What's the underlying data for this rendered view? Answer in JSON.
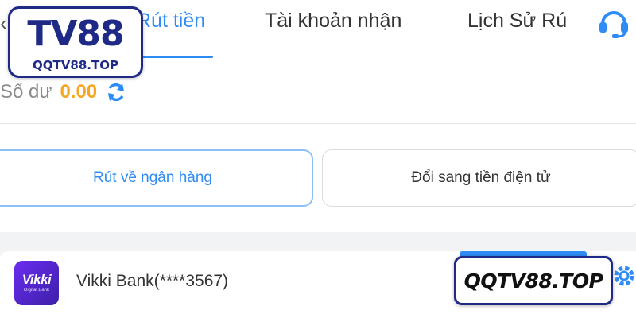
{
  "header": {
    "back_icon": "chevron-left-icon",
    "tabs": [
      {
        "label": "Rút tiền",
        "active": true
      },
      {
        "label": "Tài khoản nhận",
        "active": false
      },
      {
        "label": "Lịch Sử Rú",
        "active": false
      }
    ],
    "support_icon": "headset-icon"
  },
  "balance": {
    "label": "Số dư",
    "value": "0.00",
    "refresh_icon": "refresh-icon"
  },
  "options": [
    {
      "label": "Rút về ngân hàng",
      "selected": true
    },
    {
      "label": "Đổi sang tiền điện tử",
      "selected": false
    }
  ],
  "bank": {
    "logo_text": "Vikki",
    "logo_subtext": "Digital Bank",
    "name": "Vikki Bank(****3567)",
    "settings_icon": "gear-icon"
  },
  "watermark": {
    "logo_main": "TV88",
    "logo_sub": "QQTV88.TOP",
    "badge": "QQTV88.TOP"
  },
  "colors": {
    "accent": "#2f8cf5",
    "balance_value": "#f5a623",
    "watermark_border": "#1f2a86"
  }
}
